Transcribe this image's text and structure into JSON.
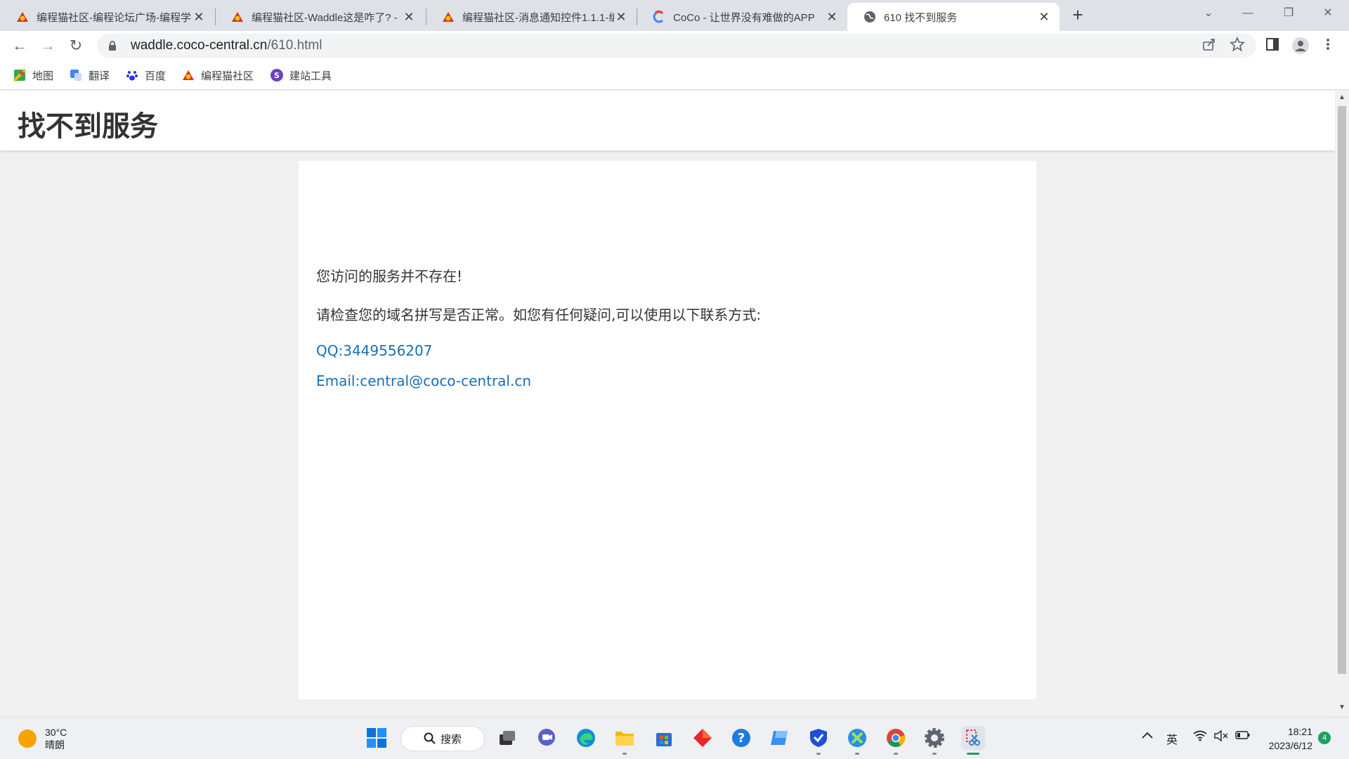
{
  "tabs": [
    {
      "title": "编程猫社区-编程论坛广场-编程学",
      "active": false
    },
    {
      "title": "编程猫社区-Waddle这是咋了? -",
      "active": false
    },
    {
      "title": "编程猫社区-消息通知控件1.1.1-编",
      "active": false
    },
    {
      "title": "CoCo - 让世界没有难做的APP",
      "active": false
    },
    {
      "title": "610 找不到服务",
      "active": true
    }
  ],
  "tab_close_glyph": "✕",
  "new_tab_glyph": "+",
  "window_controls": {
    "dropdown": "⌄",
    "minimize": "—",
    "restore": "❐",
    "close": "✕"
  },
  "nav": {
    "back": "←",
    "forward": "→",
    "reload": "↻"
  },
  "address": {
    "host": "waddle.coco-central.cn",
    "path": "/610.html"
  },
  "bookmarks": [
    {
      "label": "地图",
      "icon": "maps-icon"
    },
    {
      "label": "翻译",
      "icon": "translate-icon"
    },
    {
      "label": "百度",
      "icon": "baidu-icon"
    },
    {
      "label": "编程猫社区",
      "icon": "codemao-icon"
    },
    {
      "label": "建站工具",
      "icon": "site-tool-icon"
    }
  ],
  "page": {
    "title": "找不到服务",
    "line1": "您访问的服务并不存在!",
    "line2": "请检查您的域名拼写是否正常。如您有任何疑问,可以使用以下联系方式:",
    "qq": "QQ:3449556207",
    "email": "Email:central@coco-central.cn"
  },
  "taskbar": {
    "temperature": "30°C",
    "weather": "晴朗",
    "search_label": "搜索",
    "ime": "英",
    "time": "18:21",
    "date": "2023/6/12",
    "notifications": "4"
  },
  "colors": {
    "link": "#1a6fb5",
    "tabstrip": "#dee1e6",
    "page_bg": "#f0f0f0"
  }
}
